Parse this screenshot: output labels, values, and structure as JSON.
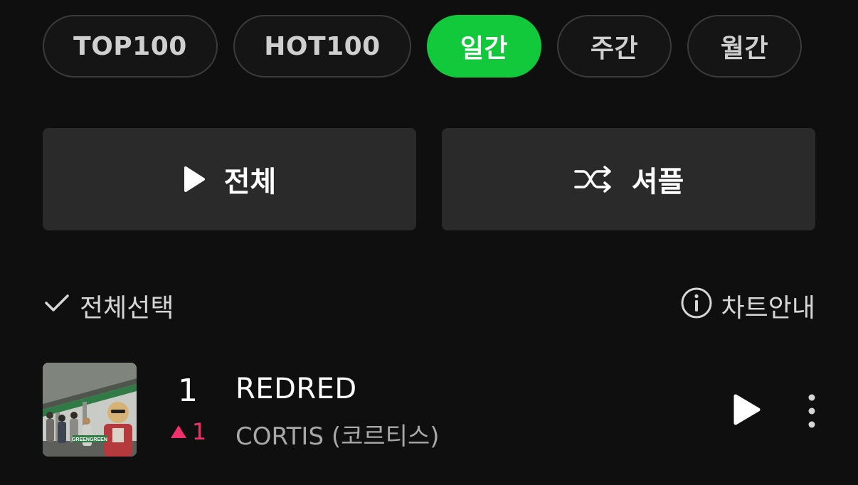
{
  "tabs": [
    {
      "label": "TOP100",
      "active": false
    },
    {
      "label": "HOT100",
      "active": false
    },
    {
      "label": "일간",
      "active": true
    },
    {
      "label": "주간",
      "active": false
    },
    {
      "label": "월간",
      "active": false
    }
  ],
  "actions": {
    "play_all_label": "전체",
    "shuffle_label": "셔플"
  },
  "toolbar": {
    "select_all_label": "전체선택",
    "chart_info_label": "차트안내"
  },
  "chart": [
    {
      "rank": "1",
      "rank_change": "1",
      "rank_direction": "up",
      "title": "REDRED",
      "artist": "CORTIS (코르티스)",
      "cover_text": "GREENGREEN"
    }
  ],
  "colors": {
    "accent": "#11c93b",
    "rank_up": "#f0306a",
    "background": "#0f0f0f",
    "button_bg": "#2a2a2a"
  },
  "icons": {
    "play": "play-icon",
    "shuffle": "shuffle-icon",
    "check": "check-icon",
    "info": "info-icon",
    "more": "more-vertical-icon",
    "rank_up": "triangle-up-icon"
  }
}
